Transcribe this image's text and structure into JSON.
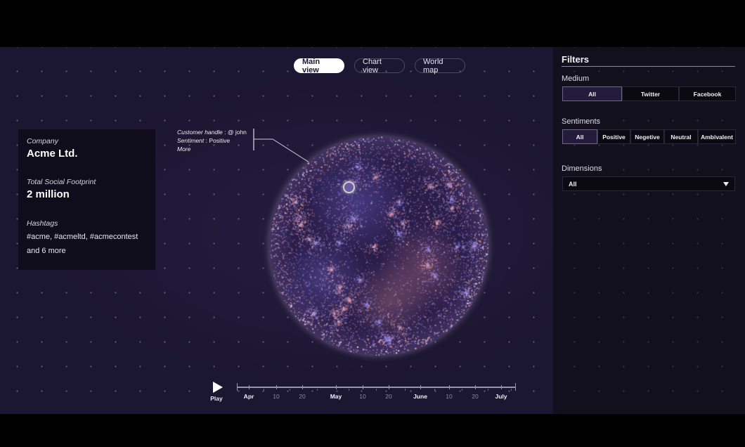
{
  "view_tabs": [
    {
      "label": "Main view",
      "active": true
    },
    {
      "label": "Chart view",
      "active": false
    },
    {
      "label": "World map",
      "active": false
    }
  ],
  "info_card": {
    "company_label": "Company",
    "company_value": "Acme Ltd.",
    "footprint_label": "Total Social Footprint",
    "footprint_value": "2 million",
    "hashtags_label": "Hashtags",
    "hashtags_value": "#acme, #acmeltd, #acmecontest",
    "hashtags_more": "and 6 more"
  },
  "tooltip": {
    "handle_label": "Customer handle",
    "handle_value": ": @ john",
    "sentiment_label": "Sentiment",
    "sentiment_value": ": Positive",
    "more_label": "More"
  },
  "visualization": {
    "colors": {
      "positive": "#e8a0a4",
      "neutral": "#8c86e8",
      "rim": "#f2dcf2",
      "marker_fill": "#6b5ca3",
      "marker_stroke": "#c9d2c6"
    }
  },
  "timeline": {
    "play_label": "Play",
    "labels": [
      {
        "text": "Apr",
        "type": "month"
      },
      {
        "text": "10",
        "type": "day"
      },
      {
        "text": "20",
        "type": "day"
      },
      {
        "text": "May",
        "type": "month"
      },
      {
        "text": "10",
        "type": "day"
      },
      {
        "text": "20",
        "type": "day"
      },
      {
        "text": "June",
        "type": "month"
      },
      {
        "text": "10",
        "type": "day"
      },
      {
        "text": "20",
        "type": "day"
      },
      {
        "text": "July",
        "type": "month"
      }
    ]
  },
  "filters": {
    "title": "Filters",
    "medium": {
      "label": "Medium",
      "options": [
        {
          "label": "All",
          "active": true
        },
        {
          "label": "Twitter",
          "active": false
        },
        {
          "label": "Facebook",
          "active": false
        }
      ]
    },
    "sentiments": {
      "label": "Sentiments",
      "options": [
        {
          "label": "All",
          "active": true
        },
        {
          "label": "Positive",
          "active": false
        },
        {
          "label": "Negetive",
          "active": false
        },
        {
          "label": "Neutral",
          "active": false
        },
        {
          "label": "Ambivalent",
          "active": false
        }
      ]
    },
    "dimensions": {
      "label": "Dimensions",
      "selected": "All"
    }
  }
}
